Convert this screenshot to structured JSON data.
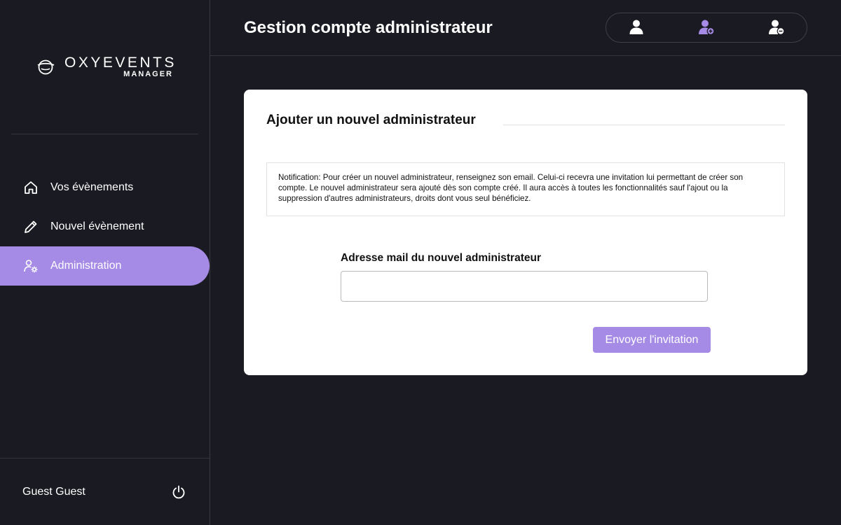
{
  "sidebar": {
    "logo": {
      "title": "OXYEVENTS",
      "subtitle": "MANAGER",
      "icon": "oxyevents-logo-icon"
    },
    "items": [
      {
        "label": "Vos évènements",
        "icon": "home-icon"
      },
      {
        "label": "Nouvel évènement",
        "icon": "pencil-icon"
      },
      {
        "label": "Administration",
        "icon": "user-gear-icon",
        "active": true
      }
    ],
    "user": {
      "name": "Guest Guest",
      "logout_icon": "power-icon"
    }
  },
  "header": {
    "title": "Gestion compte administrateur",
    "buttons": [
      {
        "icon": "user-icon",
        "color": "#ffffff"
      },
      {
        "icon": "user-add-icon",
        "color": "#a58ae6",
        "active": true
      },
      {
        "icon": "user-remove-icon",
        "color": "#ffffff"
      }
    ]
  },
  "card": {
    "title": "Ajouter un nouvel administrateur",
    "notification": "Notification: Pour créer un nouvel administrateur, renseignez son email. Celui-ci recevra une invitation lui permettant de créer son compte. Le nouvel administrateur sera ajouté dès son compte créé. Il aura accès à toutes les fonctionnalités sauf l'ajout ou la suppression d'autres administrateurs, droits dont vous seul bénéficiez.",
    "email_label": "Adresse mail du nouvel administrateur",
    "email_value": "",
    "email_placeholder": "",
    "submit_label": "Envoyer l'invitation"
  },
  "colors": {
    "background": "#1a1a22",
    "accent": "#a58ae6",
    "card": "#ffffff"
  }
}
